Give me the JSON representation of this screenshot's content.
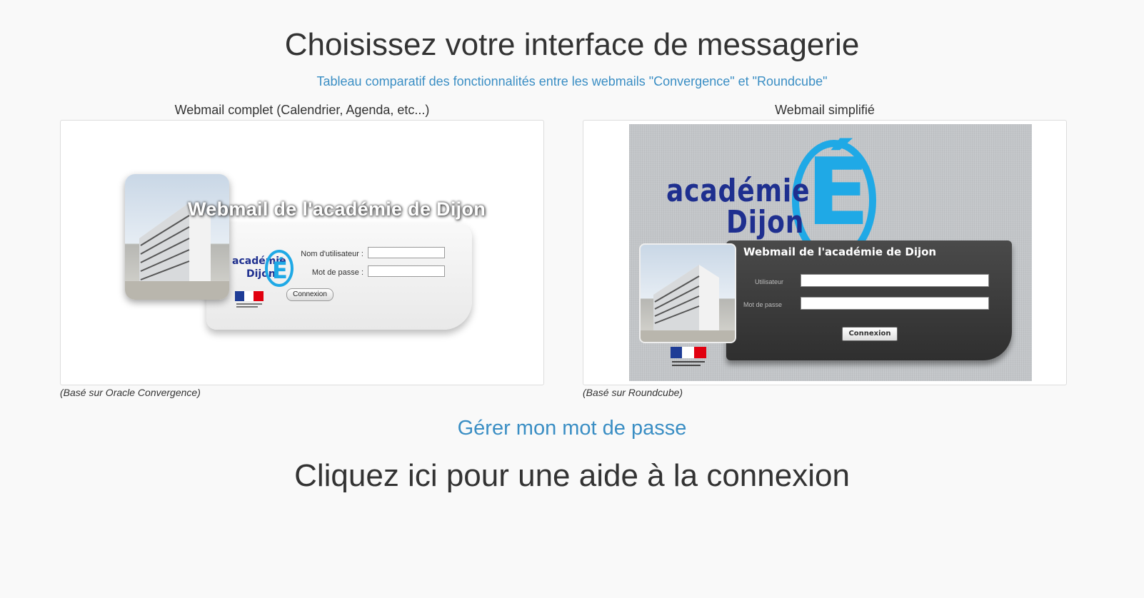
{
  "page": {
    "title": "Choisissez votre interface de messagerie",
    "compare_link": "Tableau comparatif des fonctionnalités entre les webmails \"Convergence\" et \"Roundcube\"",
    "password_link": "Gérer mon mot de passe",
    "help_title": "Cliquez ici pour une aide à la connexion",
    "link_color": "#3a8ec4",
    "text_color": "#333333",
    "background": "#f9f9f9"
  },
  "full_webmail": {
    "heading": "Webmail complet (Calendrier, Agenda, etc...)",
    "caption": "(Basé sur Oracle Convergence)",
    "thumbnail": {
      "title": "Webmail de l'académie de Dijon",
      "username_label": "Nom d'utilisateur :",
      "password_label": "Mot de passe :",
      "button_label": "Connexion",
      "logo_text_1": "académie",
      "logo_text_2": "Dijon",
      "logo_letter": "É"
    }
  },
  "simple_webmail": {
    "heading": "Webmail simplifié",
    "caption": "(Basé sur Roundcube)",
    "thumbnail": {
      "brand_line_1": "académie",
      "brand_line_2": "Dijon",
      "brand_letter": "É",
      "title": "Webmail de l'académie de Dijon",
      "username_label": "Utilisateur",
      "password_label": "Mot de passe",
      "button_label": "Connexion",
      "accent_color": "#1fa9e6",
      "brand_color": "#1e2f8f"
    }
  }
}
